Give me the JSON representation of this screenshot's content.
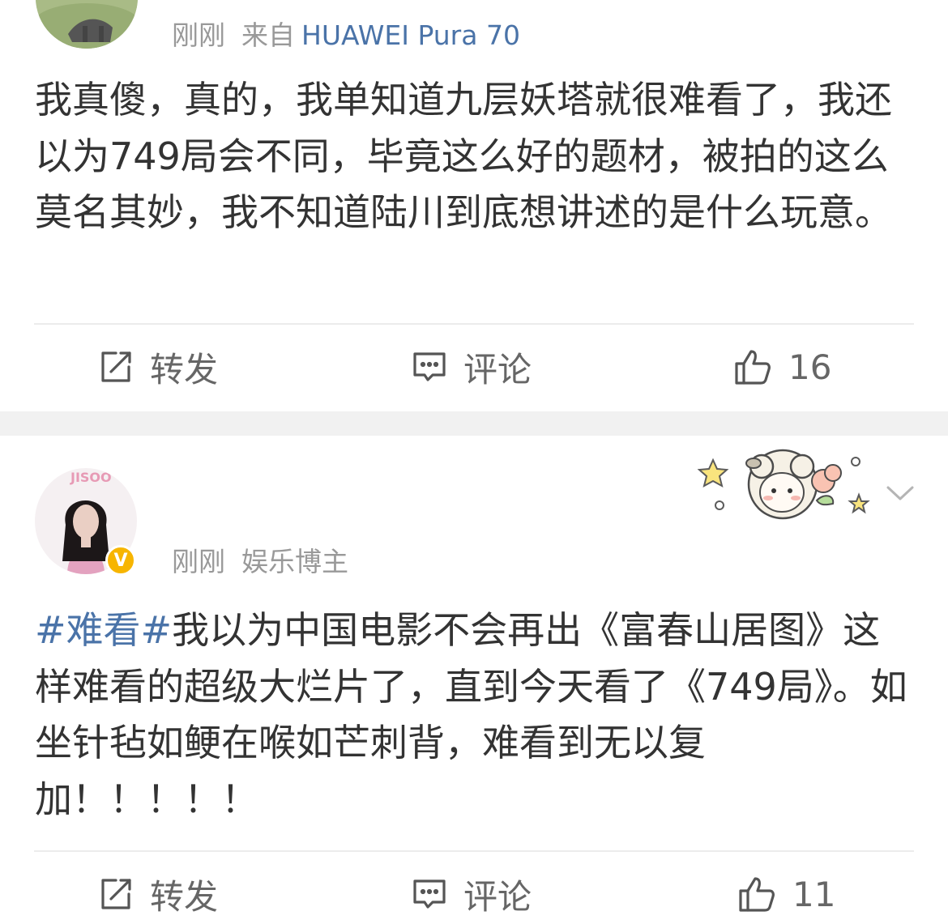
{
  "post1": {
    "time": "刚刚",
    "source_prefix": "来自",
    "source_device": "HUAWEI Pura 70",
    "content": "我真傻，真的，我单知道九层妖塔就很难看了，我还以为749局会不同，毕竟这么好的题材，被拍的这么莫名其妙，我不知道陆川到底想讲述的是什么玩意。",
    "actions": {
      "repost": "转发",
      "comment": "评论",
      "like_count": "16"
    }
  },
  "post2": {
    "time": "刚刚",
    "user_tag": "娱乐博主",
    "avatar_text": "JISOO",
    "verified_badge": "V",
    "topic": "#难看#",
    "content": "我以为中国电影不会再出《富春山居图》这样难看的超级大烂片了，直到今天看了《749局》。如坐针毡如鲠在喉如芒刺背，难看到无以复加！！！！！",
    "actions": {
      "repost": "转发",
      "comment": "评论",
      "like_count": "11"
    }
  },
  "colors": {
    "link": "#4a73a8",
    "meta": "#999999",
    "text": "#333333",
    "verified": "#f7b500",
    "separator": "#f1f1f1"
  },
  "icons": [
    "repost-icon",
    "comment-icon",
    "like-icon",
    "chevron-down-icon",
    "sheep-sticker-icon",
    "verified-icon"
  ]
}
